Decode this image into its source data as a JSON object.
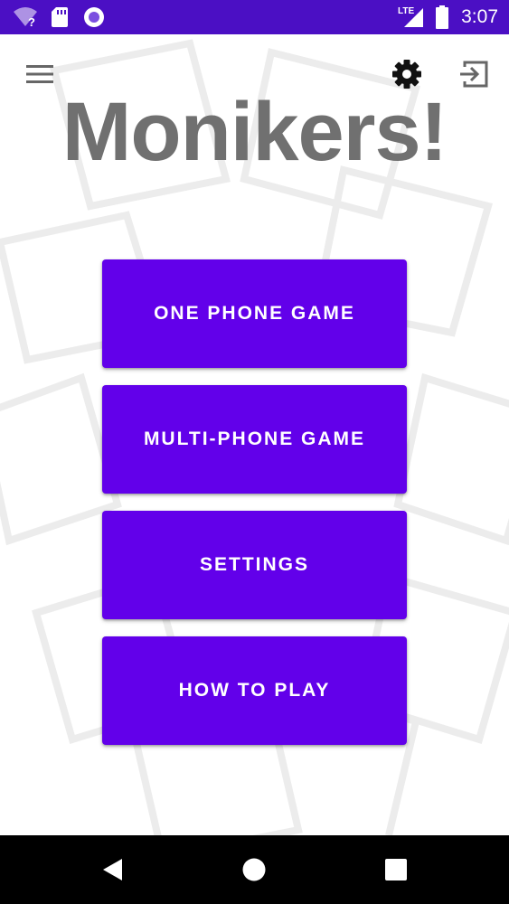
{
  "status_bar": {
    "time": "3:07",
    "network_label": "LTE",
    "icons": [
      "wifi-unknown-icon",
      "sd-card-icon",
      "recording-circle-icon",
      "lte-signal-icon",
      "battery-icon"
    ],
    "background_color": "#4b0fc4"
  },
  "toolbar": {
    "menu_icon": "hamburger-menu-icon",
    "settings_icon": "gear-icon",
    "logout_icon": "exit-icon"
  },
  "app": {
    "title": "Monikers!",
    "title_color": "#707070"
  },
  "menu": {
    "button_color": "#6200ea",
    "buttons": [
      {
        "label": "ONE PHONE GAME"
      },
      {
        "label": "MULTI-PHONE GAME"
      },
      {
        "label": "SETTINGS"
      },
      {
        "label": "HOW TO PLAY"
      }
    ]
  },
  "nav_bar": {
    "back_icon": "back-triangle-icon",
    "home_icon": "home-circle-icon",
    "recents_icon": "recents-square-icon"
  }
}
